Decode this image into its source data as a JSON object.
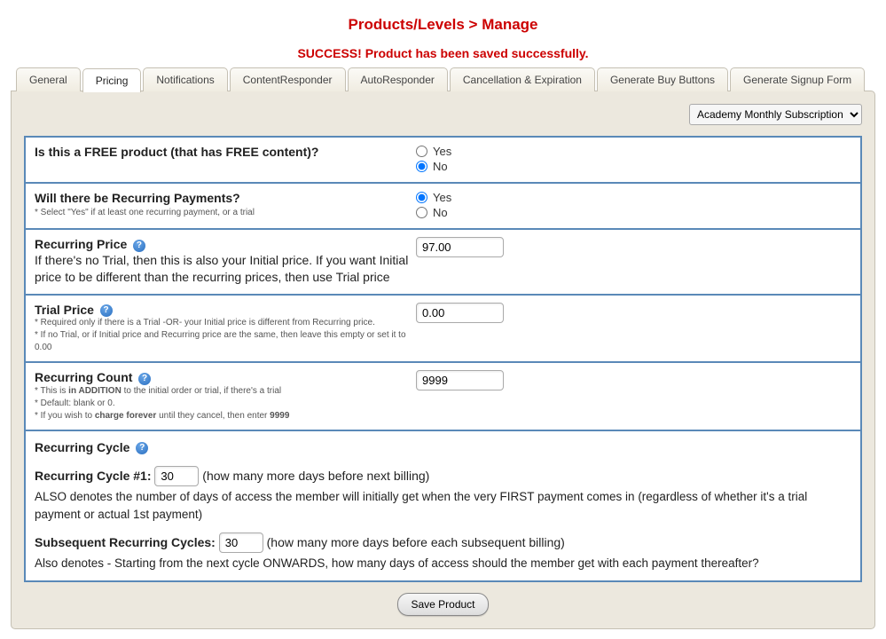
{
  "header": {
    "breadcrumb": "Products/Levels > Manage",
    "success": "SUCCESS! Product has been saved successfully."
  },
  "tabs": {
    "general": "General",
    "pricing": "Pricing",
    "notifications": "Notifications",
    "contentresponder": "ContentResponder",
    "autoresponder": "AutoResponder",
    "cancellation": "Cancellation & Expiration",
    "buybuttons": "Generate Buy Buttons",
    "signupform": "Generate Signup Form"
  },
  "productSelect": {
    "selected": "Academy Monthly Subscription"
  },
  "free": {
    "label": "Is this a FREE product (that has FREE content)?",
    "yes": "Yes",
    "no": "No",
    "value": "no"
  },
  "recurringQ": {
    "label": "Will there be Recurring Payments?",
    "hint": "* Select \"Yes\" if at least one recurring payment, or a trial",
    "yes": "Yes",
    "no": "No",
    "value": "yes"
  },
  "recurringPrice": {
    "label": "Recurring Price",
    "desc": "If there's no Trial, then this is also your Initial price. If you want Initial price to be different than the recurring prices, then use Trial price",
    "value": "97.00"
  },
  "trialPrice": {
    "label": "Trial Price",
    "hint1": "* Required only if there is a Trial -OR- your Initial price is different from Recurring price.",
    "hint2": "* If no Trial, or if Initial price and Recurring price are the same, then leave this empty or set it to 0.00",
    "value": "0.00"
  },
  "recurringCount": {
    "label": "Recurring Count",
    "hint1_a": "* This is ",
    "hint1_b": "in ADDITION",
    "hint1_c": " to the initial order or trial, if there's a trial",
    "hint2": "* Default: blank or 0.",
    "hint3_a": "* If you wish to ",
    "hint3_b": "charge forever",
    "hint3_c": " until they cancel, then enter ",
    "hint3_d": "9999",
    "value": "9999"
  },
  "cycle": {
    "header": "Recurring Cycle",
    "cycle1_label": "Recurring Cycle #1",
    "cycle1_value": "30",
    "cycle1_hint": "(how many more days before next billing)",
    "cycle1_desc": "ALSO denotes the number of days of access the member will initially get when the very FIRST payment comes in (regardless of whether it's a trial payment or actual 1st payment)",
    "subs_label": "Subsequent Recurring Cycles",
    "subs_value": "30",
    "subs_hint": "(how many more days before each subsequent billing)",
    "subs_desc": "Also denotes - Starting from the next cycle ONWARDS, how many days of access should the member get with each payment thereafter?"
  },
  "saveBtn": "Save Product",
  "helpGlyph": "?"
}
